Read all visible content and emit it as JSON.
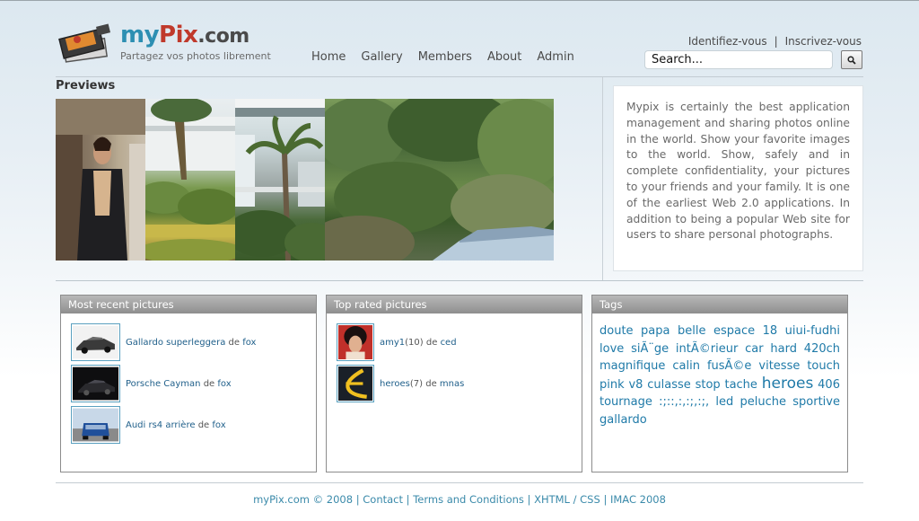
{
  "header": {
    "logo_my": "my",
    "logo_pix": "Pix",
    "logo_com": ".com",
    "tagline": "Partagez vos photos librement",
    "nav": [
      "Home",
      "Gallery",
      "Members",
      "About",
      "Admin"
    ],
    "login_label": "Identifiez-vous",
    "auth_separator": "|",
    "register_label": "Inscrivez-vous",
    "search_value": "Search..."
  },
  "previews": {
    "title": "Previews"
  },
  "description": "Mypix is certainly the best application management and sharing photos online in the world. Show your favorite images to the world. Show, safely and in complete confidentiality, your pictures to your friends and your family. It is one of the earliest Web 2.0 applications. In addition to being a popular Web site for users to share personal photographs.",
  "recent": {
    "title": "Most recent pictures",
    "items": [
      {
        "name": "Gallardo superleggera",
        "by": "de",
        "user": "fox"
      },
      {
        "name": "Porsche Cayman",
        "by": "de",
        "user": "fox"
      },
      {
        "name": "Audi rs4 arrière",
        "by": "de",
        "user": "fox"
      }
    ]
  },
  "top_rated": {
    "title": "Top rated pictures",
    "items": [
      {
        "name": "amy1",
        "score": "(10)",
        "by": "de",
        "user": "ced"
      },
      {
        "name": "heroes",
        "score": "(7)",
        "by": "de",
        "user": "mnas"
      }
    ]
  },
  "tags": {
    "title": "Tags",
    "line1": "doute papa belle espace 18 uiui-fudhi love siÃ¨ge intÃ©rieur car hard 420ch magnifique calin fusÃ©e vitesse touch pink v8 culasse stop tache",
    "big": "heroes",
    "line2": "406 tournage :;::,:,:;,:;, led peluche sportive gallardo"
  },
  "footer": {
    "copyright": "myPix.com © 2008",
    "contact": "Contact",
    "terms": "Terms and Conditions",
    "xhtml": "XHTML / CSS",
    "imac": "IMAC 2008",
    "separator": "|"
  },
  "colors": {
    "accent_blue": "#2d8fb2",
    "accent_red": "#c0392b",
    "link_blue": "#1f7aa8",
    "panel_header": "#9e9e9e"
  }
}
